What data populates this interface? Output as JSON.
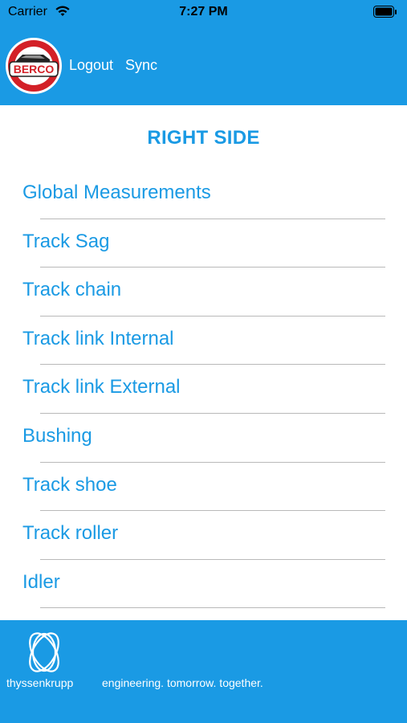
{
  "status_bar": {
    "carrier": "Carrier",
    "time": "7:27 PM",
    "wifi_icon": "wifi-icon",
    "battery_icon": "battery-icon"
  },
  "header": {
    "logo_icon": "berco-logo",
    "logo_text": "BERCO",
    "logout_label": "Logout",
    "sync_label": "Sync"
  },
  "title": "RIGHT SIDE",
  "menu": [
    {
      "label": "Global Measurements"
    },
    {
      "label": "Track Sag"
    },
    {
      "label": "Track chain"
    },
    {
      "label": "Track link Internal"
    },
    {
      "label": "Track link External"
    },
    {
      "label": "Bushing"
    },
    {
      "label": "Track shoe"
    },
    {
      "label": "Track roller"
    },
    {
      "label": "Idler"
    }
  ],
  "footer": {
    "logo_icon": "thyssenkrupp-logo",
    "brand": "thyssenkrupp",
    "tagline": "engineering. tomorrow. together."
  },
  "colors": {
    "accent": "#1a9ae4",
    "divider": "#b9b9b9",
    "logo_red": "#d32027"
  }
}
